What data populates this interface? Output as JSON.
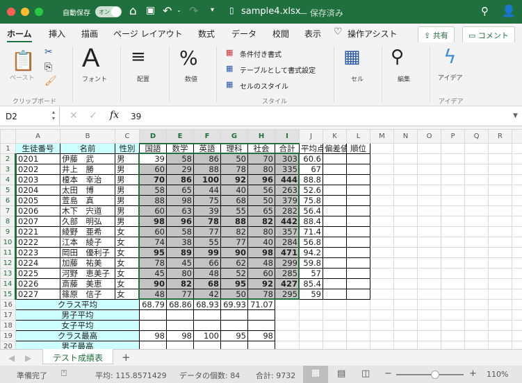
{
  "titlebar": {
    "autosave_label": "自動保存",
    "autosave_toggle": "オン",
    "filename": "sample4.xlsx",
    "save_status": "— 保存済み"
  },
  "tabs": [
    "ホーム",
    "挿入",
    "描画",
    "ページ レイアウト",
    "数式",
    "データ",
    "校閲",
    "表示"
  ],
  "tell_me": "操作アシスト",
  "share_label": "共有",
  "comment_label": "コメント",
  "ribbon": {
    "paste": "ペースト",
    "clipboard": "クリップボード",
    "font": "フォント",
    "alignment": "配置",
    "number": "数値",
    "conditional": "条件付き書式",
    "table_format": "テーブルとして書式設定",
    "cell_styles": "セルのスタイル",
    "styles": "スタイル",
    "cells": "セル",
    "editing": "編集",
    "ideas": "アイデア",
    "ideas_group": "アイデア"
  },
  "formula_bar": {
    "name_box": "D2",
    "formula": "39"
  },
  "columns": [
    "A",
    "B",
    "C",
    "D",
    "E",
    "F",
    "G",
    "H",
    "I",
    "J",
    "K",
    "L",
    "M",
    "N",
    "O",
    "P",
    "Q",
    "R",
    "S"
  ],
  "header_row": [
    "生徒番号",
    "名前",
    "性別",
    "国語",
    "数学",
    "英語",
    "理科",
    "社会",
    "合計",
    "平均点",
    "偏差値",
    "順位"
  ],
  "students": [
    [
      "0201",
      "伊藤　武",
      "男",
      39,
      58,
      86,
      50,
      70,
      303,
      60.6
    ],
    [
      "0202",
      "井上　勝",
      "男",
      60,
      29,
      88,
      78,
      80,
      335,
      67
    ],
    [
      "0203",
      "榎本　幸治",
      "男",
      70,
      86,
      100,
      92,
      96,
      444,
      88.8
    ],
    [
      "0204",
      "太田　博",
      "男",
      58,
      65,
      44,
      40,
      56,
      263,
      52.6
    ],
    [
      "0205",
      "萱島　真",
      "男",
      88,
      98,
      75,
      68,
      50,
      379,
      75.8
    ],
    [
      "0206",
      "木下　宍道",
      "男",
      60,
      63,
      39,
      55,
      65,
      282,
      56.4
    ],
    [
      "0207",
      "久部　明弘",
      "男",
      98,
      96,
      78,
      88,
      82,
      442,
      88.4
    ],
    [
      "0221",
      "綾野　亜希",
      "女",
      60,
      58,
      77,
      82,
      80,
      357,
      71.4
    ],
    [
      "0222",
      "江本　綾子",
      "女",
      74,
      38,
      55,
      77,
      40,
      284,
      56.8
    ],
    [
      "0223",
      "岡田　優利子",
      "女",
      95,
      89,
      99,
      90,
      98,
      471,
      94.2
    ],
    [
      "0224",
      "加藤　祐美",
      "女",
      78,
      45,
      66,
      62,
      48,
      299,
      59.8
    ],
    [
      "0225",
      "河野　恵美子",
      "女",
      45,
      80,
      48,
      52,
      60,
      285,
      57
    ],
    [
      "0226",
      "斎藤　美恵",
      "女",
      90,
      82,
      68,
      95,
      92,
      427,
      85.4
    ],
    [
      "0227",
      "篠原　信子",
      "女",
      48,
      77,
      42,
      50,
      78,
      295,
      59
    ]
  ],
  "bold_rows": [
    "0203",
    "0207",
    "0223",
    "0226"
  ],
  "summary": [
    {
      "label": "クラス平均",
      "values": [
        "68.79",
        "68.86",
        "68.93",
        "69.93",
        "71.07"
      ]
    },
    {
      "label": "男子平均",
      "values": [
        "",
        "",
        "",
        "",
        ""
      ]
    },
    {
      "label": "女子平均",
      "values": [
        "",
        "",
        "",
        "",
        ""
      ]
    },
    {
      "label": "クラス最高",
      "values": [
        "98",
        "98",
        "100",
        "95",
        "98"
      ]
    },
    {
      "label": "男子最高",
      "values": [
        "",
        "",
        "",
        "",
        ""
      ]
    }
  ],
  "sheet_tab": "テスト成績表",
  "status": {
    "ready": "準備完了",
    "average": "平均: 115.8571429",
    "count": "データの個数: 84",
    "sum": "合計: 9732",
    "zoom": "110%"
  },
  "zoom_level_percent": 110,
  "colors": {
    "accent": "#20703f",
    "header_fill": "#ccffff",
    "selection_fill": "#c3c3c3"
  }
}
